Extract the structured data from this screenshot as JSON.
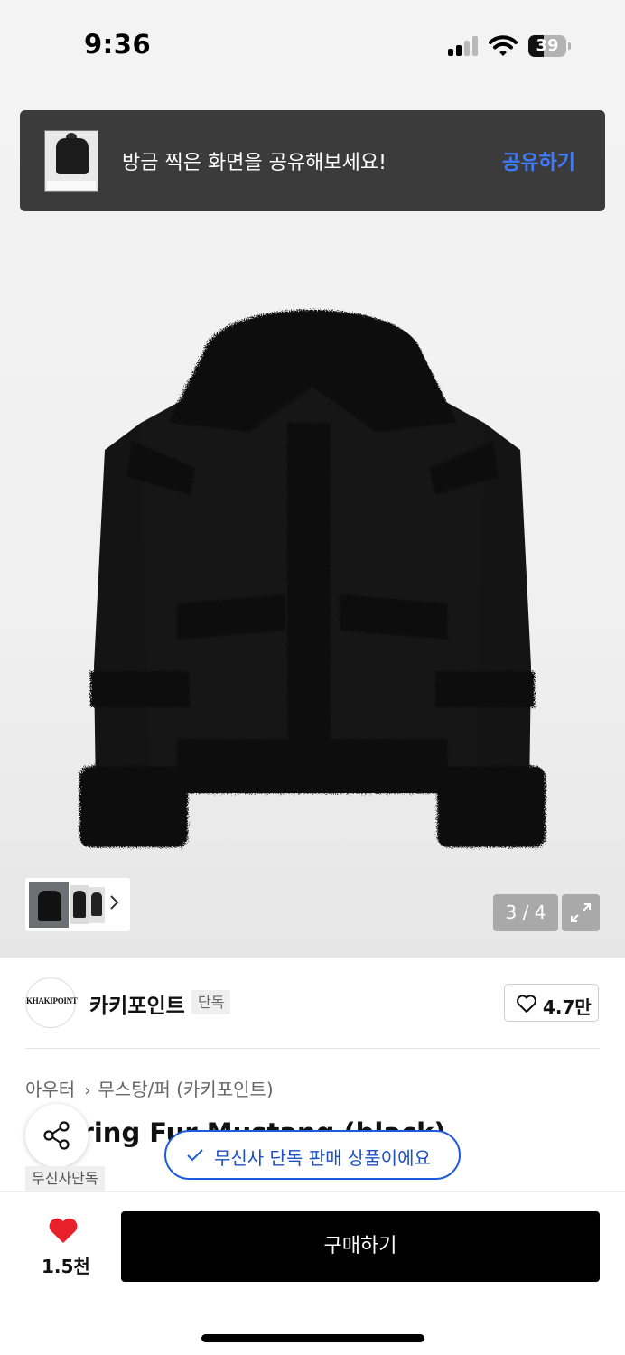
{
  "status_bar": {
    "time": "9:36",
    "battery_level": "39",
    "icons": [
      "signal-icon",
      "wifi-icon",
      "battery-icon"
    ]
  },
  "share_toast": {
    "message": "방금 찍은 화면을 공유해보세요!",
    "action_label": "공유하기",
    "action_color": "#3f7bff"
  },
  "gallery": {
    "page_counter": "3 / 4",
    "icons": [
      "chevron-right-icon",
      "expand-icon"
    ]
  },
  "brand": {
    "logo_text": "KHAKIPOINT",
    "name": "카키포인트",
    "badge": "단독",
    "like_count": "4.7만"
  },
  "product": {
    "breadcrumb": [
      "아우터",
      "무스탕/퍼 (카키포인트)"
    ],
    "title_visible": "aring Fur Mustang (black)",
    "tag": "무신사단독"
  },
  "exclusive_notice": {
    "text": "무신사 단독 판매 상품이에요",
    "color": "#1c5bd9"
  },
  "bottom_bar": {
    "wish_count": "1.5천",
    "wish_color": "#e8202a",
    "buy_label": "구매하기"
  }
}
